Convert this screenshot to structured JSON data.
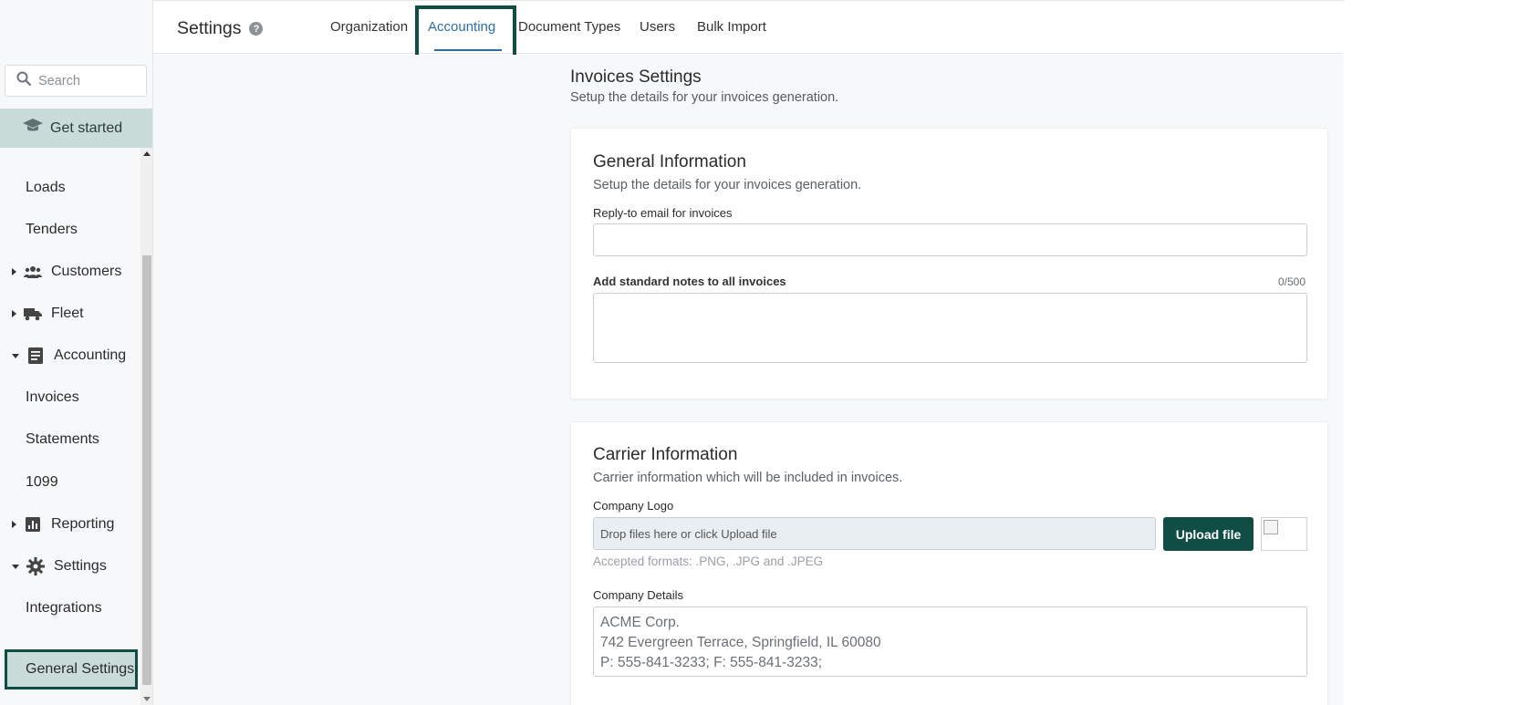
{
  "sidebar": {
    "search_placeholder": "Search",
    "get_started": "Get started",
    "items": [
      {
        "label": "Loads"
      },
      {
        "label": "Tenders"
      },
      {
        "label": "Customers"
      },
      {
        "label": "Fleet"
      },
      {
        "label": "Accounting"
      },
      {
        "label": "Invoices"
      },
      {
        "label": "Statements"
      },
      {
        "label": "1099"
      },
      {
        "label": "Reporting"
      },
      {
        "label": "Settings"
      },
      {
        "label": "Integrations"
      },
      {
        "label": "General Settings"
      }
    ]
  },
  "header": {
    "title": "Settings",
    "help_symbol": "?",
    "tabs": [
      {
        "label": "Organization"
      },
      {
        "label": "Accounting"
      },
      {
        "label": "Document Types"
      },
      {
        "label": "Users"
      },
      {
        "label": "Bulk Import"
      }
    ],
    "active_tab": "Accounting"
  },
  "invoices": {
    "title": "Invoices Settings",
    "subtitle": "Setup the details for your invoices generation."
  },
  "general": {
    "title": "General Information",
    "subtitle": "Setup the details for your invoices generation.",
    "reply_label": "Reply-to email for invoices",
    "reply_value": "",
    "notes_label": "Add standard notes to all invoices",
    "notes_counter": "0/500",
    "notes_value": ""
  },
  "carrier": {
    "title": "Carrier Information",
    "subtitle": "Carrier information which will be included in invoices.",
    "logo_label": "Company Logo",
    "dropzone_text": "Drop files here or click Upload file",
    "upload_button": "Upload file",
    "formats": "Accepted formats: .PNG, .JPG and .JPEG",
    "details_label": "Company Details",
    "details_lines": [
      "ACME Corp.",
      "742 Evergreen Terrace, Springfield, IL 60080",
      "P: 555-841-3233; F: 555-841-3233;"
    ]
  },
  "colors": {
    "brand": "#0f4d45",
    "active_tab": "#2c6ea4",
    "sidebar_active": "#c9dcd9"
  }
}
